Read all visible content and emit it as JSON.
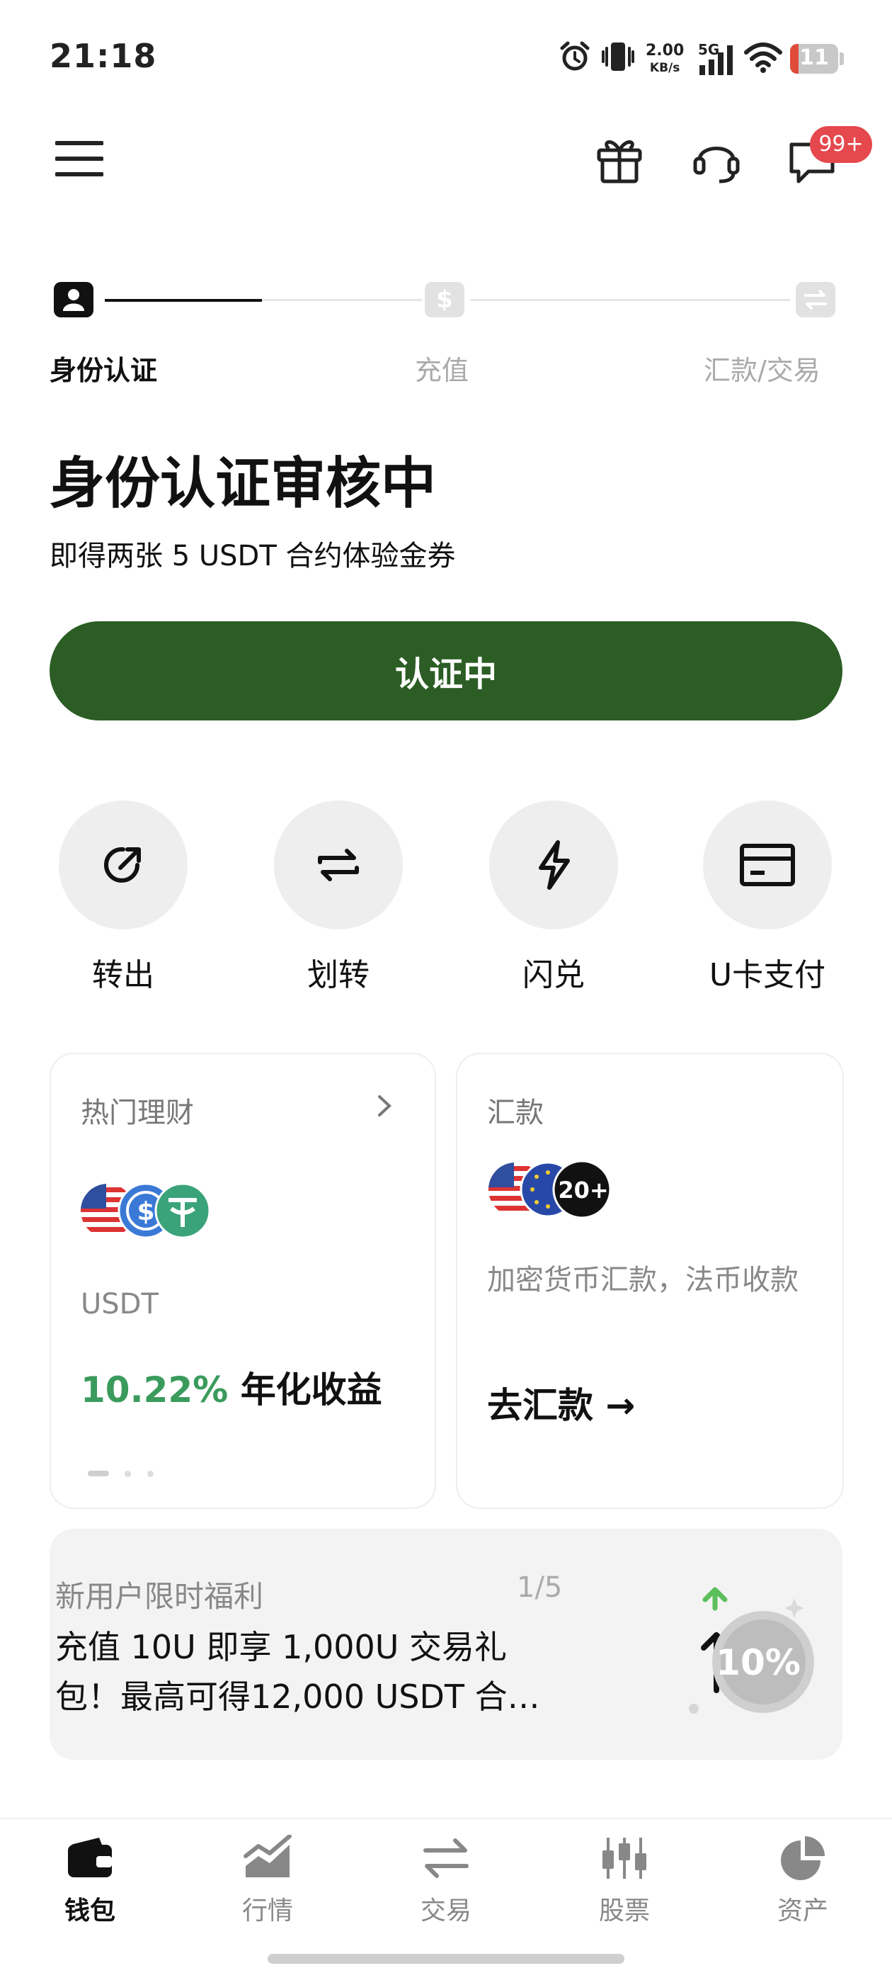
{
  "status_bar": {
    "time": "21:18",
    "net_speed_value": "2.00",
    "net_speed_unit": "KB/s",
    "network_type": "5G",
    "battery": "11",
    "battery_level": 0.11
  },
  "header": {
    "message_badge": "99+"
  },
  "progress": {
    "steps": [
      {
        "label": "身份认证",
        "state": "active"
      },
      {
        "label": "充值",
        "state": "pending"
      },
      {
        "label": "汇款/交易",
        "state": "pending"
      }
    ]
  },
  "hero": {
    "title": "身份认证审核中",
    "subtitle": "即得两张 5 USDT 合约体验金券",
    "button_label": "认证中"
  },
  "quick_actions": [
    {
      "label": "转出",
      "icon": "transfer-out-icon"
    },
    {
      "label": "划转",
      "icon": "swap-arrows-icon"
    },
    {
      "label": "闪兑",
      "icon": "lightning-icon"
    },
    {
      "label": "U卡支付",
      "icon": "card-icon"
    }
  ],
  "earn_card": {
    "title": "热门理财",
    "asset": "USDT",
    "rate": "10.22%",
    "rate_suffix": "年化收益"
  },
  "remit_card": {
    "title": "汇款",
    "coin_badge": "20+",
    "description": "加密货币汇款，法币收款",
    "cta": "去汇款 →"
  },
  "promo_banner": {
    "title": "新用户限时福利",
    "page": "1/5",
    "body": "充值 10U 即享 1,000U 交易礼包！最高可得12,000 USDT 合…",
    "badge": "10%"
  },
  "tab_bar": {
    "tabs": [
      {
        "label": "钱包",
        "active": true
      },
      {
        "label": "行情",
        "active": false
      },
      {
        "label": "交易",
        "active": false
      },
      {
        "label": "股票",
        "active": false
      },
      {
        "label": "资产",
        "active": false
      }
    ]
  },
  "colors": {
    "primary_green": "#2b5d24",
    "rate_green": "#3a9b5c",
    "badge_red": "#e5484d"
  }
}
